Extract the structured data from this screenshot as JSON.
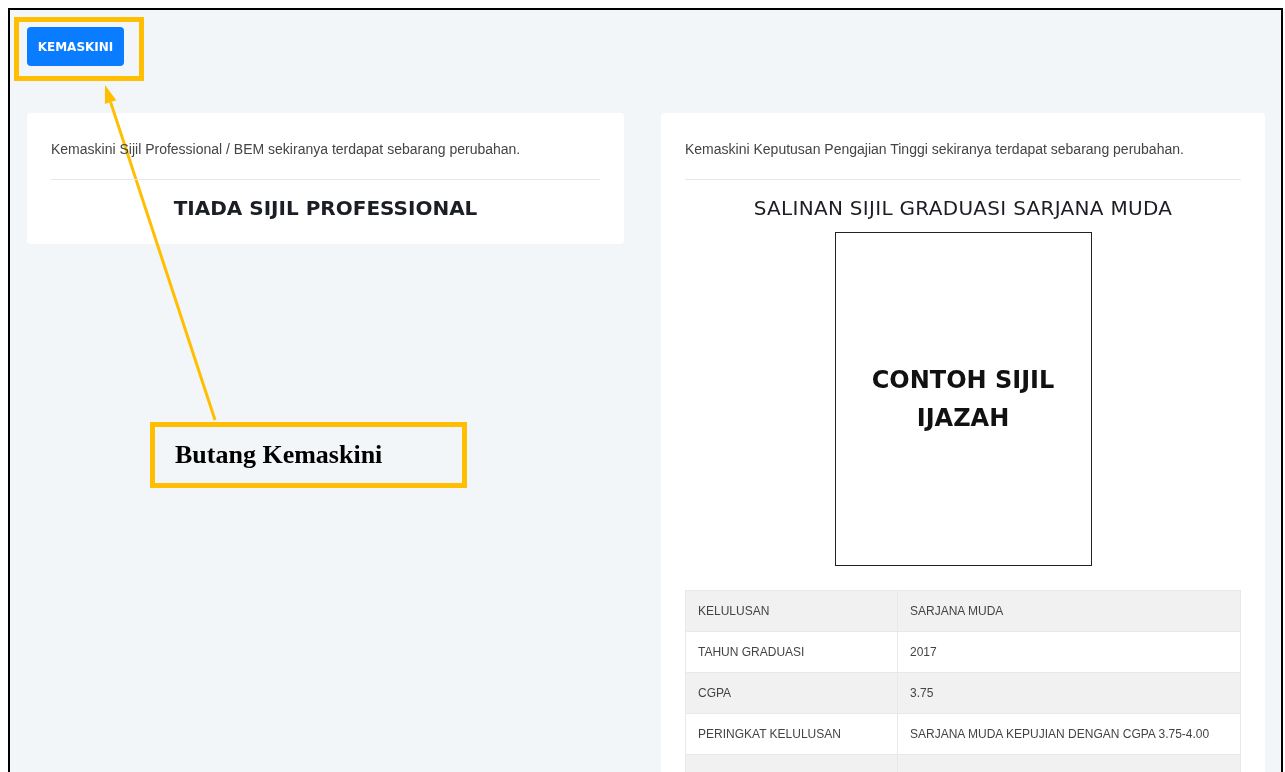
{
  "toolbar": {
    "update_button": "KEMASKINI"
  },
  "professional_card": {
    "note": "Kemaskini Sijil Professional / BEM sekiranya terdapat sebarang perubahan.",
    "heading": "TIADA SIJIL PROFESSIONAL"
  },
  "education_card": {
    "note": "Kemaskini Keputusan Pengajian Tinggi sekiranya terdapat sebarang perubahan.",
    "heading": "SALINAN SIJIL GRADUASI SARJANA MUDA",
    "certificate_text": "CONTOH SIJIL IJAZAH",
    "table": {
      "rows": [
        {
          "label": "KELULUSAN",
          "value": "SARJANA MUDA"
        },
        {
          "label": "TAHUN GRADUASI",
          "value": "2017"
        },
        {
          "label": "CGPA",
          "value": "3.75"
        },
        {
          "label": "PERINGKAT KELULUSAN",
          "value": "SARJANA MUDA KEPUJIAN DENGAN CGPA 3.75-4.00"
        }
      ]
    }
  },
  "annotation": {
    "label": "Butang Kemaskini"
  }
}
